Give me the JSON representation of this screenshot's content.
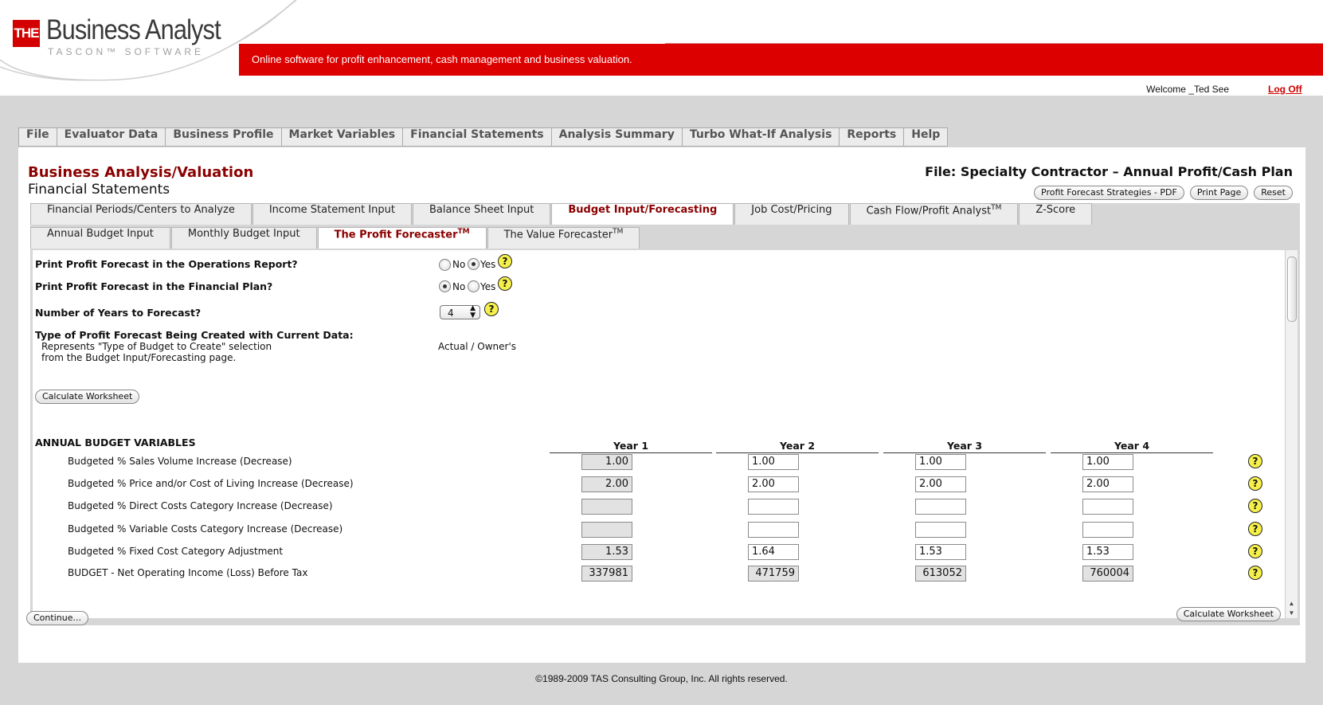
{
  "header": {
    "logo_the": "THE",
    "logo_name": "Business Analyst",
    "logo_sub": "TASCON™ SOFTWARE",
    "tagline": "Online software for profit enhancement, cash management and business valuation.",
    "welcome": "Welcome _Ted See",
    "logoff": "Log Off"
  },
  "menu": [
    "File",
    "Evaluator Data",
    "Business Profile",
    "Market Variables",
    "Financial Statements",
    "Analysis Summary",
    "Turbo What-If Analysis",
    "Reports",
    "Help"
  ],
  "page": {
    "title": "Business Analysis/Valuation",
    "subtitle": "Financial Statements",
    "file": "File: Specialty Contractor – Annual Profit/Cash Plan",
    "buttons": {
      "pdf": "Profit Forecast Strategies - PDF",
      "print": "Print Page",
      "reset": "Reset"
    }
  },
  "tabs1": [
    "Financial Periods/Centers to Analyze",
    "Income Statement Input",
    "Balance Sheet Input",
    "Budget Input/Forecasting",
    "Job Cost/Pricing",
    "Cash Flow/Profit Analyst",
    "Z-Score"
  ],
  "tabs1_tm": "TM",
  "tabs2": [
    "Annual Budget Input",
    "Monthly Budget Input",
    "The Profit Forecaster",
    "The Value Forecaster"
  ],
  "tabs2_tm": "TM",
  "form": {
    "q1": "Print Profit Forecast in the Operations Report?",
    "q2": "Print Profit Forecast in the Financial Plan?",
    "no": "No",
    "yes": "Yes",
    "q1_selected": "Yes",
    "q2_selected": "No",
    "q3": "Number of Years to Forecast?",
    "years": "4",
    "q4": "Type of Profit Forecast Being Created with Current Data:",
    "q4_note1": "Represents \"Type of Budget to Create\" selection",
    "q4_note2": "from the Budget Input/Forecasting page.",
    "q4_value": "Actual / Owner's",
    "calc": "Calculate Worksheet",
    "help": "?"
  },
  "budget": {
    "heading": "ANNUAL BUDGET VARIABLES",
    "years": [
      "Year 1",
      "Year 2",
      "Year 3",
      "Year 4"
    ],
    "rows": [
      {
        "label": "Budgeted % Sales Volume Increase (Decrease)",
        "values": [
          "1.00",
          "1.00",
          "1.00",
          "1.00"
        ]
      },
      {
        "label": "Budgeted % Price and/or Cost of Living Increase (Decrease)",
        "values": [
          "2.00",
          "2.00",
          "2.00",
          "2.00"
        ]
      },
      {
        "label": "Budgeted % Direct Costs Category Increase (Decrease)",
        "values": [
          "",
          "",
          "",
          ""
        ]
      },
      {
        "label": "Budgeted % Variable Costs Category Increase (Decrease)",
        "values": [
          "",
          "",
          "",
          ""
        ]
      },
      {
        "label": "Budgeted % Fixed Cost Category Adjustment",
        "values": [
          "1.53",
          "1.64",
          "1.53",
          "1.53"
        ]
      },
      {
        "label": "BUDGET - Net Operating Income (Loss) Before Tax",
        "values": [
          "337981",
          "471759",
          "613052",
          "760004"
        ]
      }
    ]
  },
  "bottom": {
    "continue": "Continue...",
    "calc": "Calculate Worksheet"
  },
  "footer": "©1989-2009 TAS Consulting Group, Inc. All rights reserved.",
  "colors": {
    "brand_red": "#d40000",
    "title_red": "#8b0000",
    "help_yellow": "#f6f04b"
  }
}
